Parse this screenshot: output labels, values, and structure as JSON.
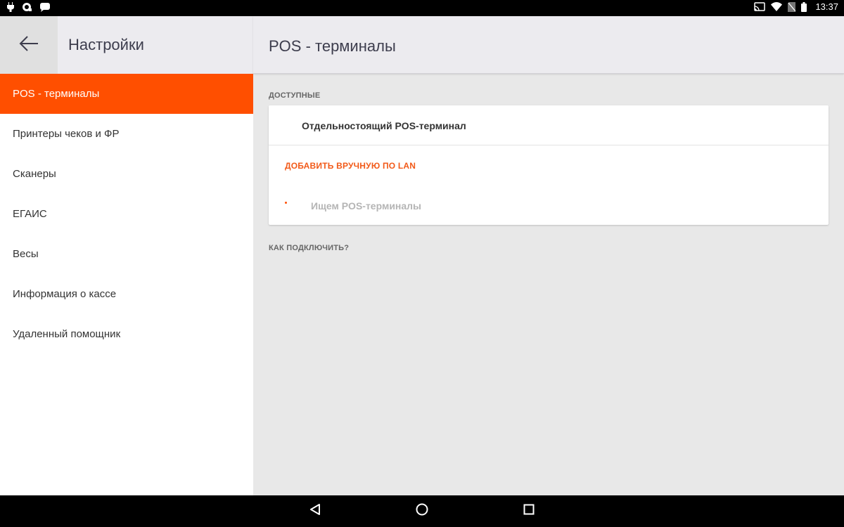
{
  "status_bar": {
    "time": "13:37",
    "left_icons": [
      "usb-plug-icon",
      "app-icon",
      "message-icon"
    ],
    "right_icons": [
      "cast-icon",
      "wifi-icon",
      "no-sim-icon",
      "battery-icon"
    ]
  },
  "left_panel": {
    "back_icon": "arrow-left-icon",
    "title": "Настройки",
    "menu": [
      {
        "label": "POS - терминалы",
        "active": true
      },
      {
        "label": "Принтеры чеков и ФР",
        "active": false
      },
      {
        "label": "Сканеры",
        "active": false
      },
      {
        "label": "ЕГАИС",
        "active": false
      },
      {
        "label": "Весы",
        "active": false
      },
      {
        "label": "Информация о кассе",
        "active": false
      },
      {
        "label": "Удаленный помощник",
        "active": false
      }
    ]
  },
  "right_panel": {
    "title": "POS - терминалы",
    "available_label": "ДОСТУПНЫЕ",
    "device_name": "Отдельностоящий POS-терминал",
    "add_lan_label": "ДОБАВИТЬ ВРУЧНУЮ ПО LAN",
    "searching_text": "Ищем POS-терминалы",
    "how_connect_label": "КАК ПОДКЛЮЧИТЬ?"
  },
  "nav_bar": {
    "buttons": [
      "back-triangle-icon",
      "home-circle-icon",
      "recents-square-icon"
    ]
  },
  "colors": {
    "accent": "#ff4f00",
    "accent_text": "#f25a19",
    "header_bg": "#ecebef",
    "content_bg": "#e8e8e8"
  }
}
